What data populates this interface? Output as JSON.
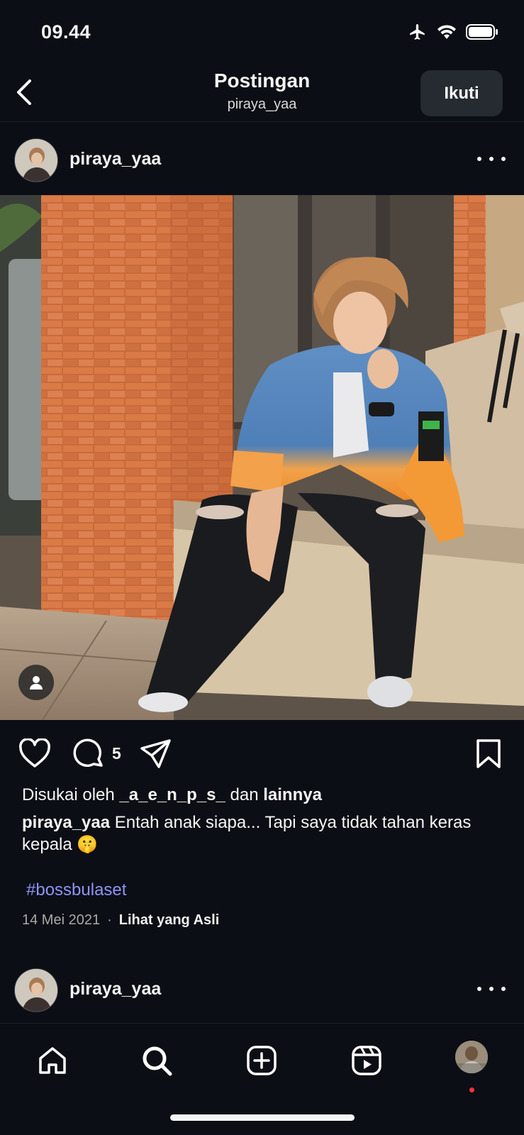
{
  "status": {
    "time": "09.44"
  },
  "nav": {
    "title": "Postingan",
    "subtitle": "piraya_yaa",
    "follow_label": "Ikuti"
  },
  "post": {
    "username": "piraya_yaa",
    "comment_count": "5",
    "likes": {
      "prefix": "Disukai oleh",
      "user": "_a_e_n_p_s_",
      "middle": "dan",
      "suffix": "lainnya"
    },
    "caption": {
      "user": "piraya_yaa",
      "text": "Entah anak siapa... Tapi saya tidak tahan keras kepala 🤫"
    },
    "hashtag": "#bossbulaset",
    "date": "14 Mei 2021",
    "separator": "·",
    "see_original": "Lihat yang Asli"
  },
  "next_post": {
    "username": "piraya_yaa"
  },
  "colors": {
    "background": "#0b0e14",
    "hashtag": "#8d94f5",
    "notification_dot": "#ff3040"
  },
  "icons": {
    "status": [
      "airplane-icon",
      "wifi-icon",
      "battery-icon"
    ],
    "actions": [
      "heart-icon",
      "comment-icon",
      "share-icon",
      "bookmark-icon"
    ],
    "tabs": [
      "home-icon",
      "search-icon",
      "create-icon",
      "reels-icon",
      "profile-icon"
    ]
  }
}
